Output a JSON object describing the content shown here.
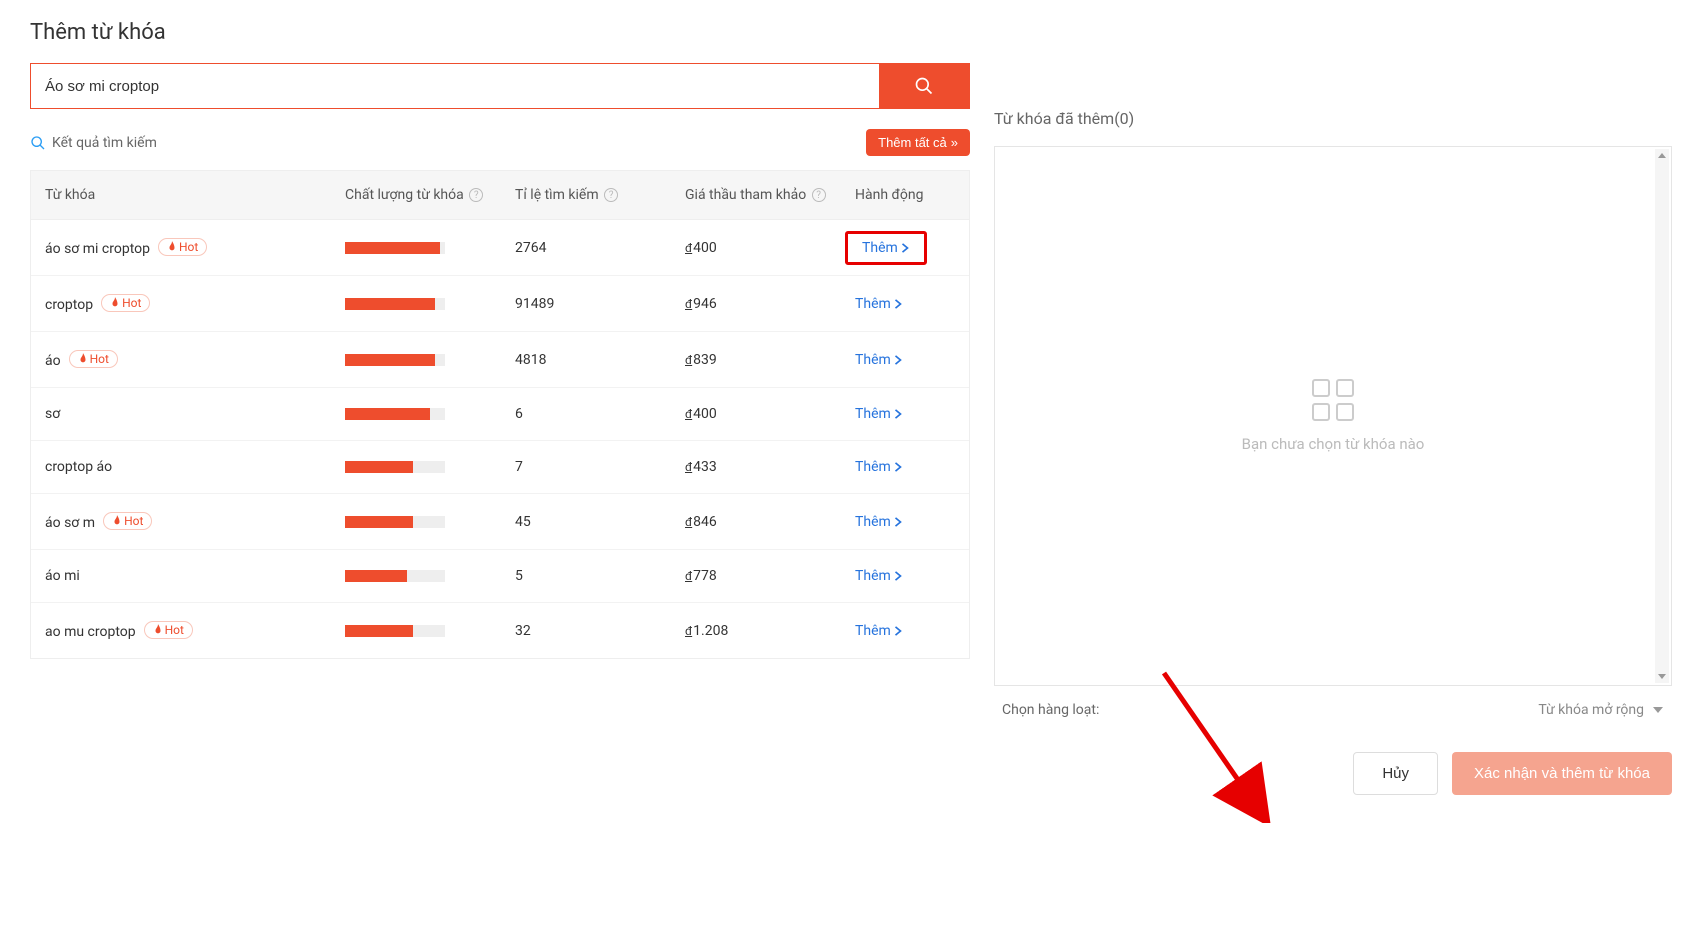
{
  "page_title": "Thêm từ khóa",
  "search": {
    "value": "Áo sơ mi croptop"
  },
  "results_label": "Kết quả tìm kiếm",
  "add_all_label": "Thêm tất cả",
  "columns": {
    "keyword": "Từ khóa",
    "quality": "Chất lượng từ khóa",
    "rate": "Tỉ lệ tìm kiếm",
    "bid": "Giá thầu tham khảo",
    "action": "Hành động"
  },
  "hot_label": "Hot",
  "add_label": "Thêm",
  "currency_symbol": "đ",
  "rows": [
    {
      "keyword": "áo sơ mi croptop",
      "hot": true,
      "quality_pct": 95,
      "rate": "2764",
      "bid": "400",
      "highlight": true
    },
    {
      "keyword": "croptop",
      "hot": true,
      "quality_pct": 90,
      "rate": "91489",
      "bid": "946",
      "highlight": false
    },
    {
      "keyword": "áo",
      "hot": true,
      "quality_pct": 90,
      "rate": "4818",
      "bid": "839",
      "highlight": false
    },
    {
      "keyword": "sơ",
      "hot": false,
      "quality_pct": 85,
      "rate": "6",
      "bid": "400",
      "highlight": false
    },
    {
      "keyword": "croptop áo",
      "hot": false,
      "quality_pct": 68,
      "rate": "7",
      "bid": "433",
      "highlight": false
    },
    {
      "keyword": "áo sơ m",
      "hot": true,
      "quality_pct": 68,
      "rate": "45",
      "bid": "846",
      "highlight": false
    },
    {
      "keyword": "áo mi",
      "hot": false,
      "quality_pct": 62,
      "rate": "5",
      "bid": "778",
      "highlight": false
    },
    {
      "keyword": "ao mu croptop",
      "hot": true,
      "quality_pct": 68,
      "rate": "32",
      "bid": "1.208",
      "highlight": false
    }
  ],
  "right": {
    "title": "Từ khóa đã thêm(0)",
    "empty_msg": "Bạn chưa chọn từ khóa nào",
    "batch_label": "Chọn hàng loạt:",
    "batch_option": "Từ khóa mở rộng"
  },
  "footer": {
    "cancel": "Hủy",
    "confirm": "Xác nhận và thêm từ khóa"
  }
}
